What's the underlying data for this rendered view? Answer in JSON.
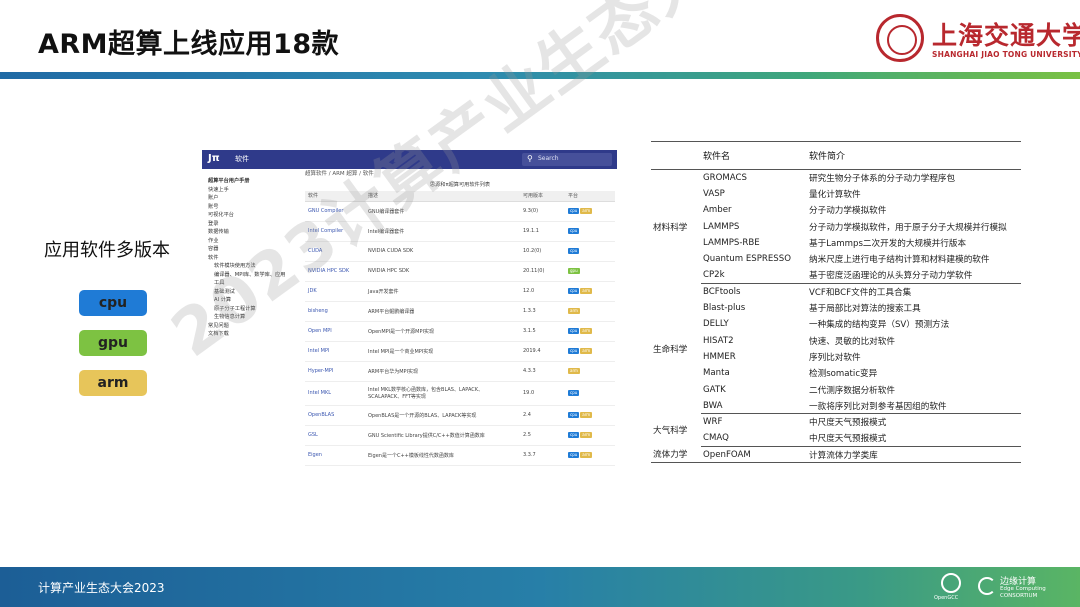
{
  "slide": {
    "title": "ARM超算上线应用18款",
    "subtitle": "应用软件多版本",
    "badges": [
      "cpu",
      "gpu",
      "arm"
    ],
    "watermark": "2023计算产业生态大会",
    "footer": "计算产业生态大会2023"
  },
  "logos": {
    "university_cn": "上海交通大学",
    "university_en": "SHANGHAI JIAO TONG UNIVERSITY",
    "opengcc": "OpenGCC",
    "edge_cn": "边缘计算",
    "edge_en1": "Edge Computing",
    "edge_en2": "CONSORTIUM"
  },
  "screenshot": {
    "nav_title": "软件",
    "search_placeholder": "Search",
    "breadcrumb": "超算软件 / ARM 超算 / 软件",
    "caption": "思源和π超算可用软件列表",
    "sidebar": [
      {
        "label": "超算平台用户手册",
        "type": "h"
      },
      {
        "label": "快速上手",
        "type": ""
      },
      {
        "label": "账户",
        "type": ""
      },
      {
        "label": "账号",
        "type": ""
      },
      {
        "label": "可视化平台",
        "type": ""
      },
      {
        "label": "登录",
        "type": ""
      },
      {
        "label": "数据传输",
        "type": ""
      },
      {
        "label": "作业",
        "type": ""
      },
      {
        "label": "容器",
        "type": ""
      },
      {
        "label": "软件",
        "type": ""
      },
      {
        "label": "软件模块使用方法",
        "type": "sub"
      },
      {
        "label": "编译器、MPI库、数学库、应用",
        "type": "sub"
      },
      {
        "label": "工具",
        "type": "sub"
      },
      {
        "label": "基础测试",
        "type": "sub"
      },
      {
        "label": "AI 计算",
        "type": "sub"
      },
      {
        "label": "原子分子工程计算",
        "type": "sub"
      },
      {
        "label": "生物信息计算",
        "type": "sub"
      },
      {
        "label": "常见问题",
        "type": ""
      },
      {
        "label": "文档下载",
        "type": ""
      }
    ],
    "columns": [
      "软件",
      "描述",
      "可用版本",
      "平台"
    ],
    "rows": [
      {
        "name": "GNU Compiler",
        "desc": "GNU编译器套件",
        "version": "9.3(0)",
        "platforms": [
          "cpu",
          "arm"
        ]
      },
      {
        "name": "Intel Compiler",
        "desc": "Intel编译器套件",
        "version": "19.1.1",
        "platforms": [
          "cpu"
        ]
      },
      {
        "name": "CUDA",
        "desc": "NVIDIA CUDA SDK",
        "version": "10.2(0)",
        "platforms": [
          "cpu"
        ]
      },
      {
        "name": "NVIDIA HPC SDK",
        "desc": "NVIDIA HPC SDK",
        "version": "20.11(0)",
        "platforms": [
          "gpu"
        ]
      },
      {
        "name": "JDK",
        "desc": "Java开发套件",
        "version": "12.0",
        "platforms": [
          "cpu",
          "arm"
        ]
      },
      {
        "name": "bisheng",
        "desc": "ARM平台鲲鹏编译器",
        "version": "1.3.3",
        "platforms": [
          "arm"
        ]
      },
      {
        "name": "Open MPI",
        "desc": "OpenMPI是一个开源MPI实现",
        "version": "3.1.5",
        "platforms": [
          "cpu",
          "arm"
        ]
      },
      {
        "name": "Intel MPI",
        "desc": "Intel MPI是一个商业MPI实现",
        "version": "2019.4",
        "platforms": [
          "cpu",
          "arm"
        ]
      },
      {
        "name": "Hyper-MPI",
        "desc": "ARM平台华为MPI实现",
        "version": "4.3.3",
        "platforms": [
          "arm"
        ]
      },
      {
        "name": "Intel MKL",
        "desc": "Intel MKL数学核心函数库，包含BLAS、LAPACK、SCALAPACK、FFT等实现",
        "version": "19.0",
        "platforms": [
          "cpu"
        ]
      },
      {
        "name": "OpenBLAS",
        "desc": "OpenBLAS是一个开源的BLAS、LAPACK等实现",
        "version": "2.4",
        "platforms": [
          "cpu",
          "arm"
        ]
      },
      {
        "name": "GSL",
        "desc": "GNU Scientific Library提供C/C++数值计算函数库",
        "version": "2.5",
        "platforms": [
          "cpu",
          "arm"
        ]
      },
      {
        "name": "Eigen",
        "desc": "Eigen是一个C++模板线性代数函数库",
        "version": "3.3.7",
        "platforms": [
          "cpu",
          "arm"
        ]
      }
    ]
  },
  "apps_table": {
    "headers": [
      "软件名",
      "软件简介"
    ],
    "groups": [
      {
        "field": "材料科学",
        "rows": [
          {
            "name": "GROMACS",
            "desc": "研究生物分子体系的分子动力学程序包"
          },
          {
            "name": "VASP",
            "desc": "量化计算软件"
          },
          {
            "name": "Amber",
            "desc": "分子动力学模拟软件"
          },
          {
            "name": "LAMMPS",
            "desc": "分子动力学模拟软件，用于原子分子大规模并行模拟"
          },
          {
            "name": "LAMMPS-RBE",
            "desc": "基于Lammps二次开发的大规模并行版本"
          },
          {
            "name": "Quantum ESPRESSO",
            "desc": "纳米尺度上进行电子结构计算和材料建模的软件"
          },
          {
            "name": "CP2k",
            "desc": "基于密度泛函理论的从头算分子动力学软件"
          }
        ]
      },
      {
        "field": "生命科学",
        "rows": [
          {
            "name": "BCFtools",
            "desc": "VCF和BCF文件的工具合集"
          },
          {
            "name": "Blast-plus",
            "desc": "基于局部比对算法的搜索工具"
          },
          {
            "name": "DELLY",
            "desc": "一种集成的结构变异（SV）预测方法"
          },
          {
            "name": "HISAT2",
            "desc": "快速、灵敏的比对软件"
          },
          {
            "name": "HMMER",
            "desc": "序列比对软件"
          },
          {
            "name": "Manta",
            "desc": "检测somatic变异"
          },
          {
            "name": "GATK",
            "desc": "二代测序数据分析软件"
          },
          {
            "name": "BWA",
            "desc": "一款将序列比对到参考基因组的软件"
          }
        ]
      },
      {
        "field": "大气科学",
        "rows": [
          {
            "name": "WRF",
            "desc": "中尺度天气预报模式"
          },
          {
            "name": "CMAQ",
            "desc": "中尺度天气预报模式"
          }
        ]
      },
      {
        "field": "流体力学",
        "rows": [
          {
            "name": "OpenFOAM",
            "desc": "计算流体力学类库"
          }
        ]
      }
    ]
  }
}
